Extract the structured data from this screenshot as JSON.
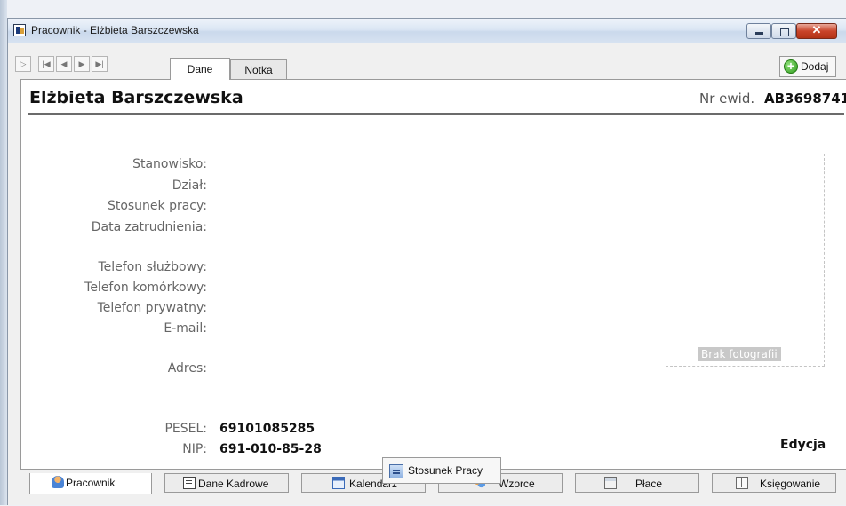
{
  "window": {
    "title": "Pracownik - Elżbieta Barszczewska"
  },
  "window_controls": {
    "close_glyph": "✕"
  },
  "toolbar": {
    "nav_buttons": [
      "▷",
      "|◀",
      "◀",
      "▶",
      "▶|"
    ],
    "tabs": [
      {
        "label": "Dane",
        "active": true
      },
      {
        "label": "Notka",
        "active": false
      }
    ],
    "add_button": {
      "label": "Dodaj",
      "glyph": "+",
      "icon": "plus-circle-icon",
      "icon_color": "#2f9b1d"
    }
  },
  "employee": {
    "name": "Elżbieta Barszczewska",
    "nr_label": "Nr ewid.",
    "nr_value": "AB3698741"
  },
  "fields": {
    "stanowisko": "Stanowisko:",
    "dzial": "Dział:",
    "stosunek": "Stosunek pracy:",
    "data_zatrudnienia": "Data zatrudnienia:",
    "tel_sluzbowy": "Telefon służbowy:",
    "tel_komorkowy": "Telefon komórkowy:",
    "tel_prywatny": "Telefon prywatny:",
    "email": "E-mail:",
    "adres": "Adres:"
  },
  "ids": {
    "pesel_label": "PESEL:",
    "pesel_value": "69101085285",
    "nip_label": "NIP:",
    "nip_value": "691-010-85-28"
  },
  "photo": {
    "placeholder": "Brak fotografii"
  },
  "edit_label": "Edycja",
  "stosunek_button": {
    "label": "Stosunek Pracy",
    "icon": "document-icon"
  },
  "bottom_tabs": [
    {
      "label": "Pracownik",
      "icon": "person-icon",
      "active": true
    },
    {
      "label": "Dane Kadrowe",
      "icon": "page-icon",
      "active": false
    },
    {
      "label": "Kalendarz",
      "icon": "calendar-icon",
      "active": false
    },
    {
      "label": "Wzorce",
      "icon": "people-icon",
      "active": false
    },
    {
      "label": "Płace",
      "icon": "calculator-icon",
      "active": false
    },
    {
      "label": "Księgowanie",
      "icon": "ledger-icon",
      "active": false
    }
  ],
  "colors": {
    "accent": "#2f9b1d",
    "close": "#c9442a",
    "titlebar": "#dbe6f4"
  }
}
